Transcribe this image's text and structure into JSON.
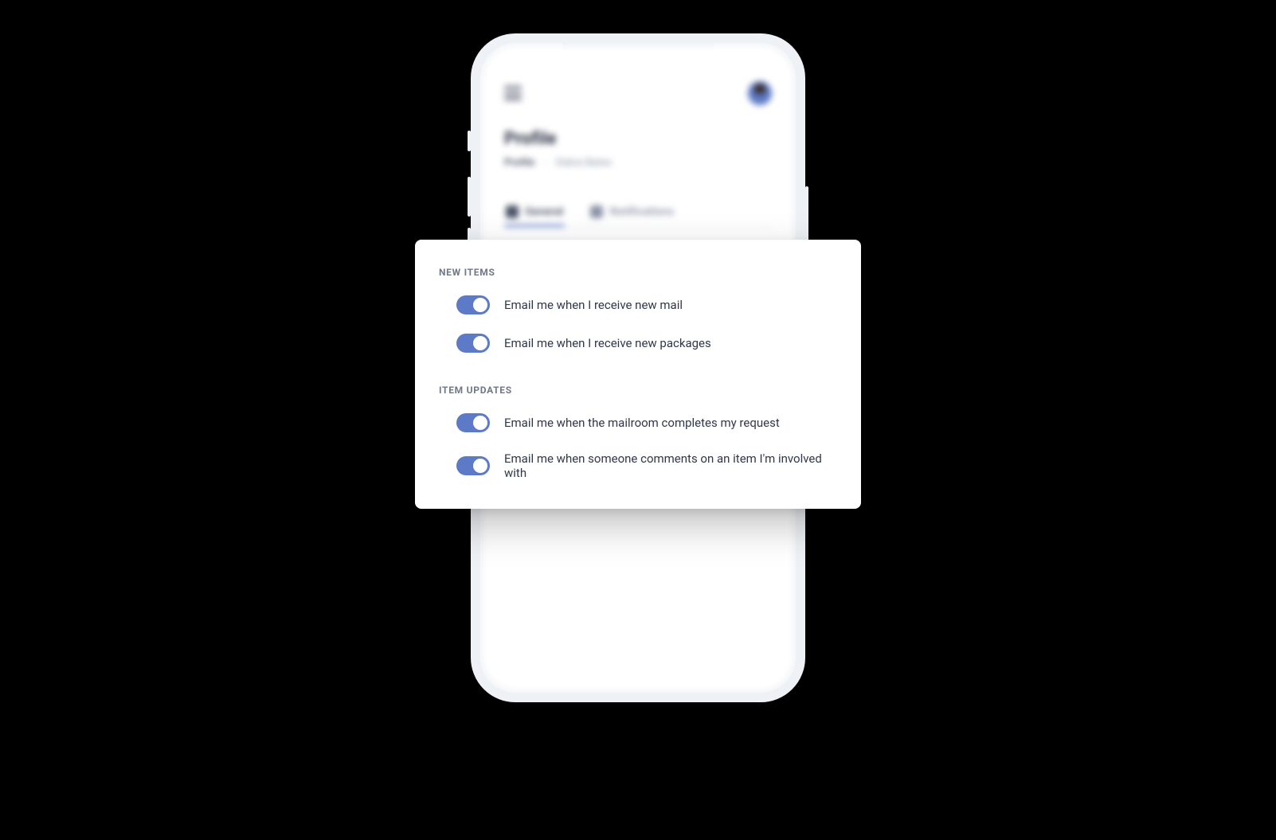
{
  "phone": {
    "page_title": "Profile",
    "breadcrumb": {
      "root": "Profile",
      "current": "Debra Bates"
    },
    "tabs": [
      {
        "label": "General",
        "active": true
      },
      {
        "label": "Notifications",
        "active": false
      }
    ]
  },
  "settings": {
    "sections": [
      {
        "title": "NEW ITEMS",
        "rows": [
          {
            "label": "Email me when I receive new mail",
            "on": true
          },
          {
            "label": "Email me when I receive new packages",
            "on": true
          }
        ]
      },
      {
        "title": "ITEM UPDATES",
        "rows": [
          {
            "label": "Email me when the mailroom completes my request",
            "on": true
          },
          {
            "label": "Email me when someone comments on an item I'm involved with",
            "on": true
          }
        ]
      }
    ]
  }
}
